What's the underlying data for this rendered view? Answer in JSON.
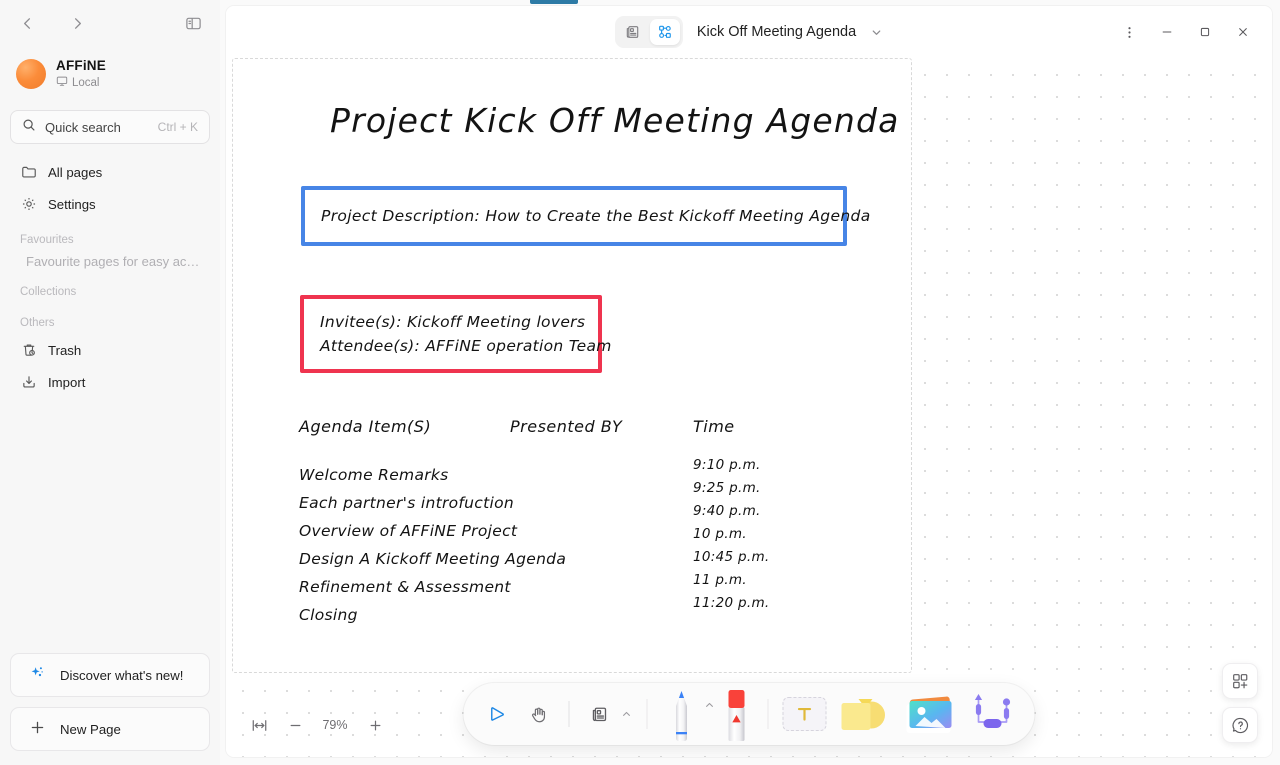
{
  "window": {
    "title": "Kick Off Meeting Agenda",
    "more_label": "⋮",
    "minimize_label": "–",
    "maximize_label": "□",
    "close_label": "×"
  },
  "sidebar": {
    "back_label": "‹",
    "forward_label": "›",
    "toggle_label": "Collapse sidebar",
    "workspace": {
      "name": "AFFiNE",
      "sub": "Local"
    },
    "search": {
      "label": "Quick search",
      "shortcut": "Ctrl + K"
    },
    "nav": [
      {
        "label": "All pages",
        "icon": "folder-icon"
      },
      {
        "label": "Settings",
        "icon": "gear-icon"
      }
    ],
    "sections": [
      {
        "label": "Favourites",
        "hint": "Favourite pages for easy acc..."
      },
      {
        "label": "Collections",
        "hint": ""
      },
      {
        "label": "Others",
        "hint": ""
      }
    ],
    "others": [
      {
        "label": "Trash",
        "icon": "trash-icon"
      },
      {
        "label": "Import",
        "icon": "import-icon"
      }
    ],
    "discover_label": "Discover what's new!",
    "new_page_label": "New Page"
  },
  "modes": {
    "page_label": "Page mode",
    "edgeless_label": "Edgeless mode",
    "active": "edgeless"
  },
  "document": {
    "heading": "Project Kick Off Meeting Agenda",
    "description_box": "Project Description: How to Create the Best Kickoff Meeting Agenda",
    "invitee_box": {
      "line1": "Invitee(s): Kickoff Meeting lovers",
      "line2": "Attendee(s): AFFiNE operation Team"
    },
    "agenda": {
      "headers": [
        "Agenda Item(S)",
        "Presented BY",
        "Time"
      ],
      "items": [
        "Welcome Remarks",
        "Each partner's introfuction",
        "Overview of AFFiNE Project",
        "Design A Kickoff Meeting Agenda",
        "Refinement & Assessment",
        "Closing"
      ],
      "presented_by": [
        "",
        "",
        "",
        "",
        "",
        ""
      ],
      "times": [
        "9:10 p.m.",
        "9:25 p.m.",
        "9:40 p.m.",
        "10 p.m.",
        "10:45 p.m.",
        "11 p.m.",
        "11:20 p.m."
      ]
    }
  },
  "zoom_bar": {
    "fit_label": "Fit to screen",
    "zoom_out_label": "−",
    "value": "79%",
    "zoom_in_label": "+"
  },
  "toolbar": {
    "select_label": "Select",
    "hand_label": "Hand",
    "note_label": "Note",
    "note_caret": "⌃",
    "pen_label": "Pen",
    "pen_caret": "⌃",
    "eraser_label": "Eraser",
    "text_label": "T",
    "shape_label": "Shape",
    "image_label": "Image",
    "connector_label": "Connector / Frame"
  },
  "fabs": {
    "widgets_label": "Add widget",
    "help_label": "Help"
  },
  "colors": {
    "accent_blue": "#1e96eb",
    "box_blue": "#4785e6",
    "box_red": "#ef344f",
    "brand_orange": "#fb8c3a",
    "tab_accent": "#2e7ba6"
  }
}
